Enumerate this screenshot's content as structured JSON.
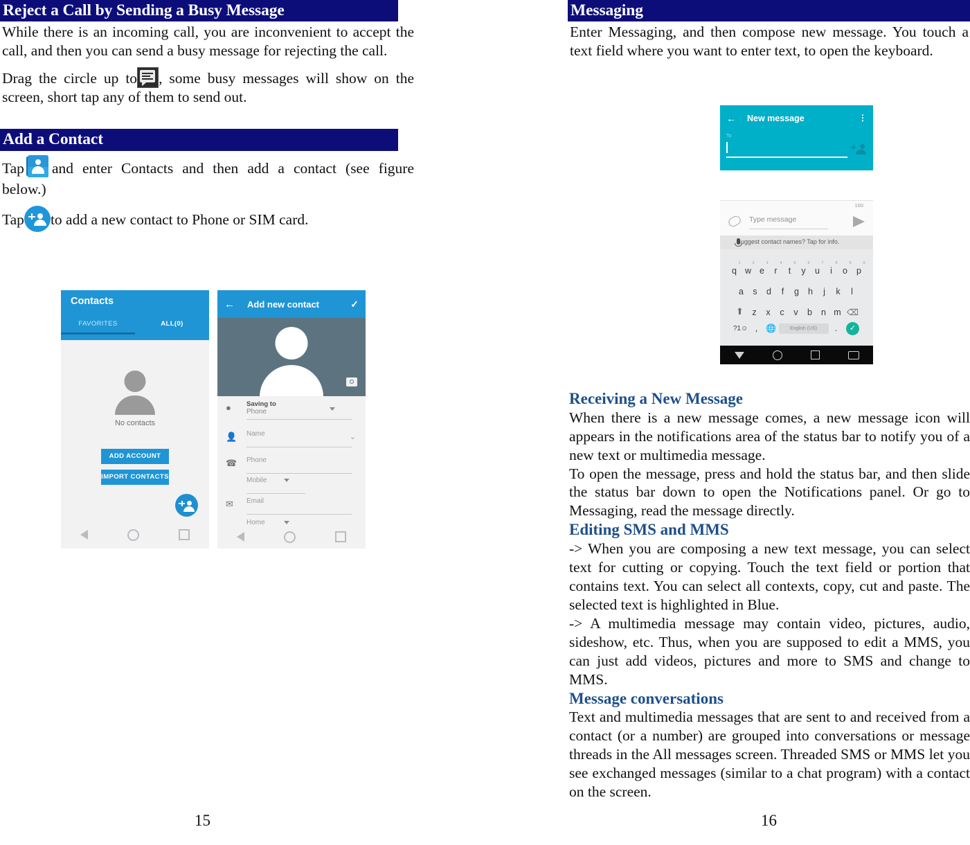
{
  "document": {
    "left_page_number": "15",
    "right_page_number": "16",
    "heading_bar_color": "#0d0d7a",
    "subheading_color": "#1e4f8a"
  },
  "left_column": {
    "section1": {
      "heading": "Reject a Call by Sending a Busy Message",
      "para1": "While there is an incoming call, you are inconvenient to accept the call, and then you can send a busy message for rejecting the call.",
      "para2_before_icon": "Drag the circle up to",
      "para2_after_icon": ", some busy messages will show on the screen, short tap any of them to send out.",
      "icon_name": "busy-message-icon"
    },
    "section2": {
      "heading": "Add a Contact",
      "para1_before_icon": "Tap",
      "para1_after_icon": "and enter Contacts and then add a contact (see figure below.)",
      "icon_name": "contacts-app-icon",
      "para2_before_icon": "Tap",
      "para2_after_icon": "to add a new contact to Phone or SIM card.",
      "icon2_name": "add-contact-fab-icon"
    }
  },
  "right_column": {
    "section1": {
      "heading": "Messaging",
      "para1": "Enter Messaging, and then compose new message. You touch a text field where you want to enter text, to open the keyboard."
    },
    "section2": {
      "subheading": "Receiving a New Message",
      "para1": "When there is a new message comes, a new message icon will appears in the notifications area of the status bar to notify you of a new text or multimedia message.",
      "para2": "To open the message, press and hold the status bar, and then slide the status bar down to open the Notifications panel. Or go to Messaging, read the message directly."
    },
    "section3": {
      "subheading": "Editing SMS and MMS",
      "para1": "-> When you are composing a new text message, you can select text for cutting or copying. Touch the text field or portion that contains text. You can select all contexts, copy, cut and paste. The selected text is highlighted in Blue.",
      "para2": "-> A multimedia message may contain video, pictures, audio, sideshow, etc. Thus, when you are supposed to edit a MMS, you can just add videos, pictures and more to SMS and change to MMS."
    },
    "section4": {
      "subheading": "Message conversations",
      "para1": "Text and multimedia messages that are sent to and received from a contact (or a number) are grouped into conversations or message threads in the All messages screen. Threaded SMS or MMS let you see exchanged messages (similar to a chat program) with a contact on the screen."
    }
  },
  "screenshots": {
    "contacts": {
      "app_bar_title": "Contacts",
      "app_bar_color": "#1f95d5",
      "tabs": [
        {
          "label": "FAVORITES",
          "active": false
        },
        {
          "label": "ALL(0)",
          "active": true
        }
      ],
      "empty_state": "No contacts",
      "buttons": [
        {
          "label": "ADD ACCOUNT"
        },
        {
          "label": "IMPORT CONTACTS"
        }
      ],
      "fab_name": "add-contact-fab"
    },
    "add_new_contact": {
      "app_bar_title": "Add new contact",
      "back_icon": "arrow-left-icon",
      "confirm_icon": "check-icon",
      "camera_icon": "camera-icon",
      "fields": [
        {
          "icon": "account-circle-icon",
          "label": "Saving to",
          "value": "Phone",
          "has_dropdown": true
        },
        {
          "icon": "person-icon",
          "label": "Name",
          "value": "",
          "has_chevron": true
        },
        {
          "icon": "phone-icon",
          "label": "Phone",
          "value": ""
        },
        {
          "icon": "",
          "label": "Mobile",
          "value": "",
          "has_dropdown": true
        },
        {
          "icon": "email-icon",
          "label": "Email",
          "value": ""
        },
        {
          "icon": "",
          "label": "Home",
          "value": "",
          "has_dropdown": true
        }
      ]
    },
    "new_message": {
      "app_bar_title": "New message",
      "app_bar_color": "#00b0c8",
      "back_icon": "arrow-left-icon",
      "overflow_icon": "more-vert-icon",
      "to_label": "To",
      "add_recipient_icon": "add-person-icon",
      "char_counter": "160",
      "attach_icon": "paperclip-icon",
      "compose_placeholder": "Type message",
      "send_icon": "send-icon",
      "suggestion_bar": "Suggest contact names? Tap for info.",
      "mic_icon": "microphone-icon",
      "keyboard": {
        "row1": [
          {
            "k": "q",
            "n": "1"
          },
          {
            "k": "w",
            "n": "2"
          },
          {
            "k": "e",
            "n": "3"
          },
          {
            "k": "r",
            "n": "4"
          },
          {
            "k": "t",
            "n": "5"
          },
          {
            "k": "y",
            "n": "6"
          },
          {
            "k": "u",
            "n": "7"
          },
          {
            "k": "i",
            "n": "8"
          },
          {
            "k": "o",
            "n": "9"
          },
          {
            "k": "p",
            "n": "0"
          }
        ],
        "row2": [
          "a",
          "s",
          "d",
          "f",
          "g",
          "h",
          "j",
          "k",
          "l"
        ],
        "row3": [
          "z",
          "x",
          "c",
          "v",
          "b",
          "n",
          "m"
        ],
        "shift_icon": "shift-icon",
        "backspace_icon": "backspace-icon",
        "symbols_key": "?1☺",
        "comma_key": ",",
        "globe_icon": "language-globe-icon",
        "space_key": "English (US)",
        "period_key": ".",
        "enter_icon": "check-circle-icon"
      },
      "nav": {
        "back_icon": "nav-back-triangle-icon",
        "home_icon": "nav-home-circle-icon",
        "recents_icon": "nav-recents-square-icon",
        "keyboard_icon": "nav-keyboard-icon"
      }
    }
  }
}
